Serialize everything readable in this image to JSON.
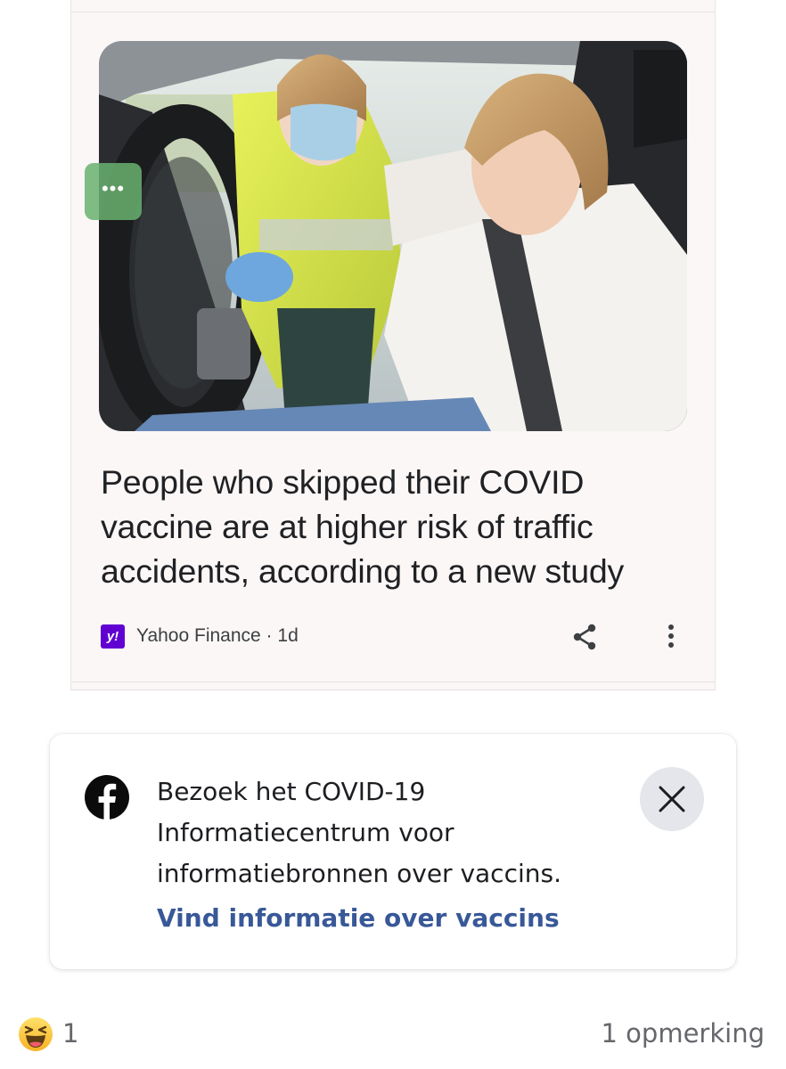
{
  "news_card": {
    "overflow_chip_label": "•••",
    "headline": "People who skipped their COVID vaccine are at higher risk of traffic accidents, according to a new study",
    "source": {
      "logo_text": "y!",
      "name": "Yahoo Finance",
      "separator": " · ",
      "age": "1d",
      "logo_color": "#6001d2"
    },
    "icons": [
      "share-icon",
      "more-vert-icon"
    ],
    "image_subject": "photo"
  },
  "info_card": {
    "logo_icon": "facebook-icon",
    "message": "Bezoek het COVID-19 Informatiecentrum voor informatiebronnen over vaccins.",
    "link_label": "Vind informatie over vaccins",
    "link_color": "#385898",
    "close_icon": "close-icon"
  },
  "footer": {
    "reaction_icon": "laughing-emoji-icon",
    "reaction_count": "1",
    "comment_count_label": "1 opmerking"
  }
}
